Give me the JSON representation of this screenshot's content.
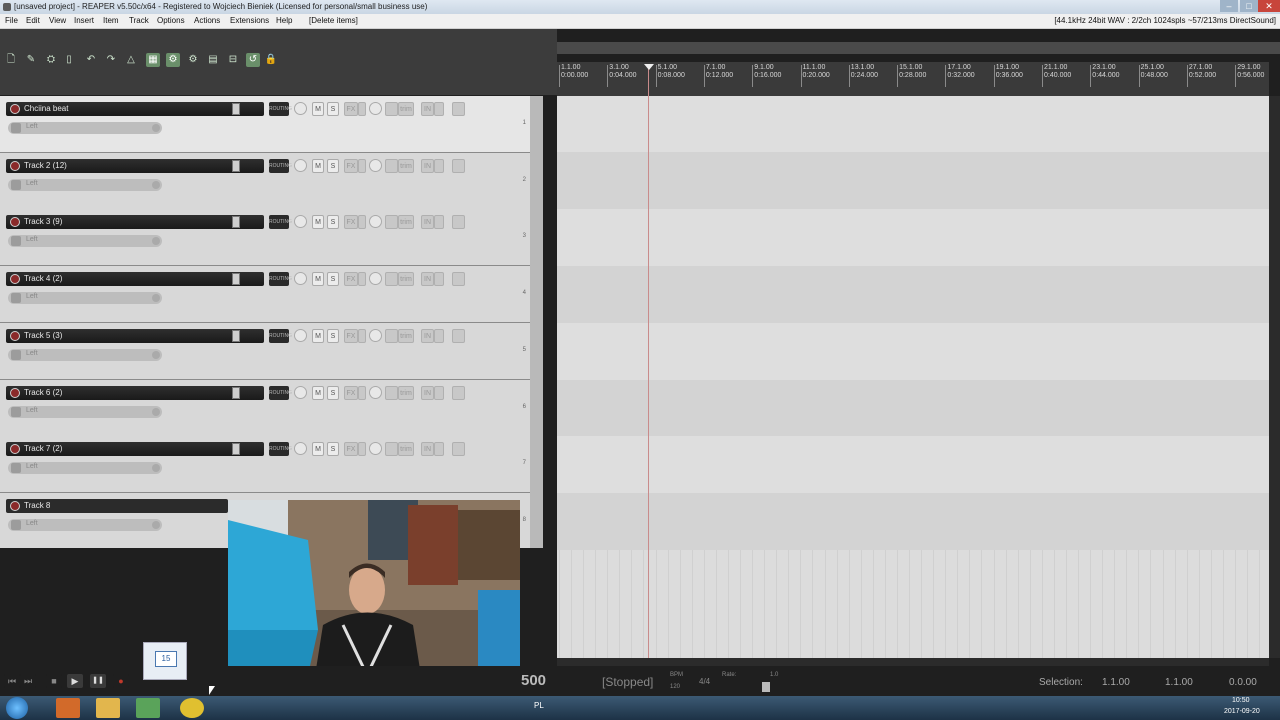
{
  "window": {
    "title": "[unsaved project] - REAPER v5.50c/x64 - Registered to Wojciech Bieniek (Licensed for personal/small business use)",
    "controls": {
      "minimize": "–",
      "maximize": "□",
      "close": "✕"
    }
  },
  "menu": {
    "items": [
      "File",
      "Edit",
      "View",
      "Insert",
      "Item",
      "Track",
      "Options",
      "Actions",
      "Extensions",
      "Help",
      "[Delete items]"
    ],
    "audio_status": "[44.1kHz 24bit WAV : 2/2ch 1024spls ~57/213ms DirectSound]"
  },
  "toolbar": {
    "icons": [
      "new-project-icon",
      "open-project-icon",
      "save-project-icon",
      "project-settings-icon",
      "undo-icon",
      "redo-icon",
      "metronome-icon",
      "grid-snap-icon",
      "ripple-edit-icon",
      "item-grouping-icon",
      "auto-crossfade-icon",
      "envelope-lock-icon",
      "snap-grid-icon",
      "lock-icon"
    ],
    "glyphs": [
      "🗋",
      "✎",
      "⛭",
      "▯",
      "↶",
      "↷",
      "△",
      "▦",
      "⚙",
      "⚙",
      "▤",
      "⊟",
      "↺",
      "🔒"
    ]
  },
  "ruler": {
    "marks": [
      {
        "bar": "1.1.00",
        "time": "0:00.000"
      },
      {
        "bar": "3.1.00",
        "time": "0:04.000"
      },
      {
        "bar": "5.1.00",
        "time": "0:08.000"
      },
      {
        "bar": "7.1.00",
        "time": "0:12.000"
      },
      {
        "bar": "9.1.00",
        "time": "0:16.000"
      },
      {
        "bar": "11.1.00",
        "time": "0:20.000"
      },
      {
        "bar": "13.1.00",
        "time": "0:24.000"
      },
      {
        "bar": "15.1.00",
        "time": "0:28.000"
      },
      {
        "bar": "17.1.00",
        "time": "0:32.000"
      },
      {
        "bar": "19.1.00",
        "time": "0:36.000"
      },
      {
        "bar": "21.1.00",
        "time": "0:40.000"
      },
      {
        "bar": "23.1.00",
        "time": "0:44.000"
      },
      {
        "bar": "25.1.00",
        "time": "0:48.000"
      },
      {
        "bar": "27.1.00",
        "time": "0:52.000"
      },
      {
        "bar": "29.1.00",
        "time": "0:56.000"
      }
    ]
  },
  "tracks": [
    {
      "name": "Chciina beat",
      "num": "1",
      "input": "Left"
    },
    {
      "name": "Track 2 (12)",
      "num": "2",
      "input": "Left"
    },
    {
      "name": "Track 3 (9)",
      "num": "3",
      "input": "Left"
    },
    {
      "name": "Track 4 (2)",
      "num": "4",
      "input": "Left"
    },
    {
      "name": "Track 5 (3)",
      "num": "5",
      "input": "Left"
    },
    {
      "name": "Track 6 (2)",
      "num": "6",
      "input": "Left"
    },
    {
      "name": "Track 7 (2)",
      "num": "7",
      "input": "Left"
    },
    {
      "name": "Track 8",
      "num": "8",
      "input": "Left"
    }
  ],
  "track_controls": {
    "route": "ROUTING",
    "mute": "M",
    "solo": "S",
    "fx": "FX",
    "trim": "trim",
    "in": "IN"
  },
  "transport": {
    "stop": "■",
    "play": "▶",
    "pause": "❚❚",
    "record": "●",
    "rewind": "⏮",
    "forward": "⏭",
    "tempo_display": "500",
    "state": "[Stopped]",
    "bpm_label": "BPM",
    "bpm_value": "120",
    "time_signature": "4/4",
    "rate_label": "Rate:",
    "rate_value": "1.0",
    "selection_label": "Selection:",
    "selection_start": "1.1.00",
    "selection_end": "1.1.00",
    "selection_length": "0.0.00"
  },
  "taskbar": {
    "calendar_badge": "15",
    "language": "PL",
    "time": "10:50",
    "date": "2017-09-20"
  }
}
